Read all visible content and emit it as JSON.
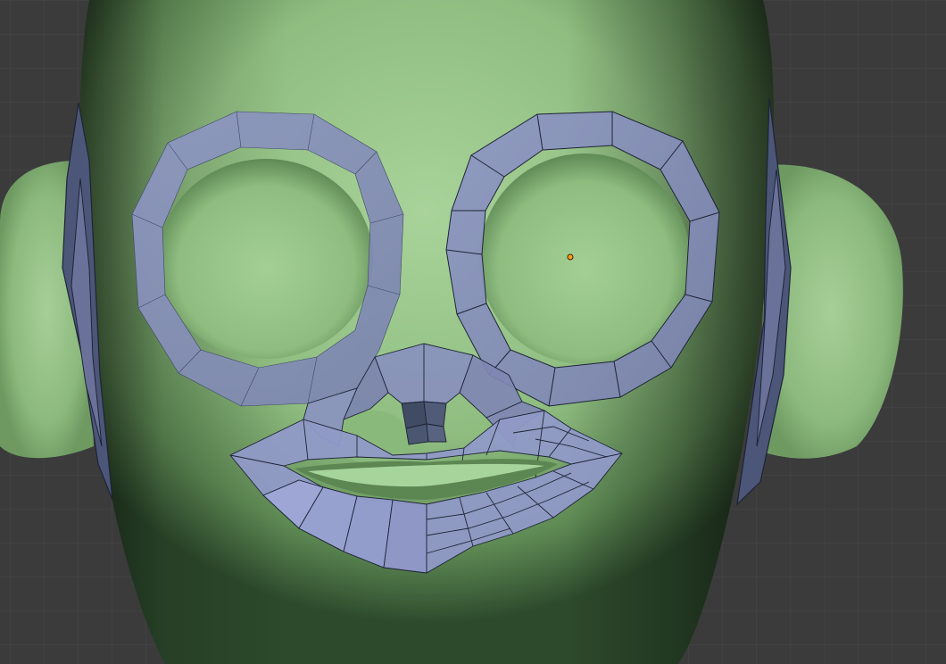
{
  "viewport": {
    "background_color": "#3b3b3b",
    "grid_color": "#4a4a4a",
    "mesh_face_color": "#8e98c4",
    "mesh_edge_color": "#1e2436",
    "sculpt_base_color": "#9cc78e"
  },
  "mesh": {
    "icons": [
      "origin-point-icon"
    ]
  }
}
